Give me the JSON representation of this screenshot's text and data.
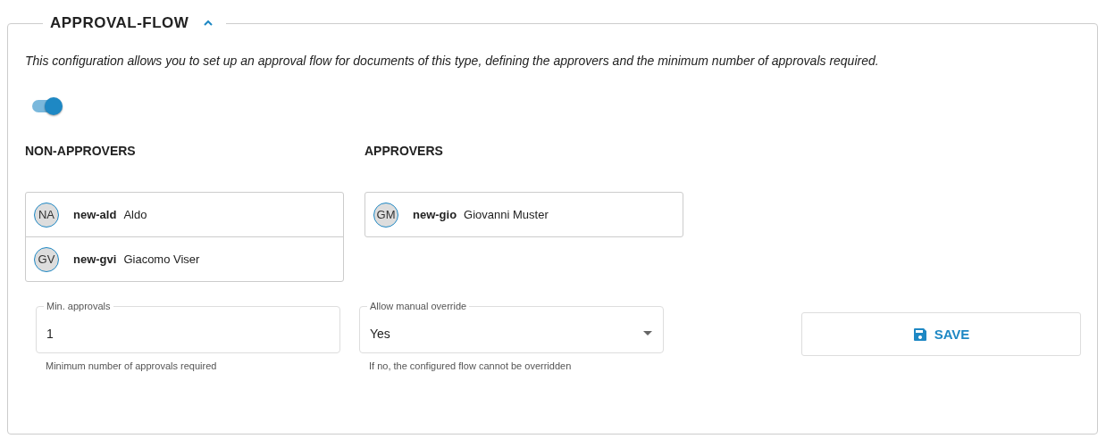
{
  "section": {
    "title": "APPROVAL-FLOW",
    "expanded": true
  },
  "description": "This configuration allows you to set up an approval flow for documents of this type, defining the approvers and the minimum number of approvals required.",
  "toggle": {
    "on": true
  },
  "non_approvers": {
    "heading": "NON-APPROVERS",
    "users": [
      {
        "initials": "NA",
        "username": "new-ald",
        "name": "Aldo"
      },
      {
        "initials": "GV",
        "username": "new-gvi",
        "name": "Giacomo Viser"
      }
    ]
  },
  "approvers": {
    "heading": "APPROVERS",
    "users": [
      {
        "initials": "GM",
        "username": "new-gio",
        "name": "Giovanni Muster"
      }
    ]
  },
  "fields": [
    {
      "kind": "text",
      "label": "Min. approvals",
      "value": "1",
      "hint": "Minimum number of approvals required"
    },
    {
      "kind": "select",
      "label": "Allow manual override",
      "value": "Yes",
      "hint": "If no, the configured flow cannot be overridden"
    }
  ],
  "save_button": "SAVE"
}
